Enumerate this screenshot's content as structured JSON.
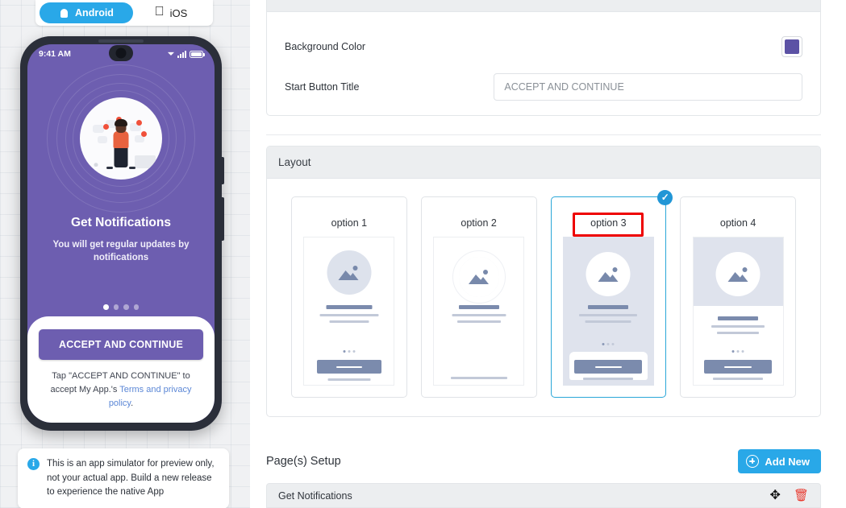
{
  "preview": {
    "platform_tabs": [
      {
        "label": "Android",
        "icon": "android-icon",
        "active": true
      },
      {
        "label": "iOS",
        "icon": "apple-icon",
        "active": false
      }
    ],
    "phone": {
      "status_time": "9:41 AM",
      "status_icons": [
        "wifi-icon",
        "signal-bars-icon",
        "battery-icon"
      ],
      "title": "Get Notifications",
      "subtitle": "You will get regular updates by notifications",
      "pager_dots": 4,
      "pager_active_index": 0,
      "cta_label": "ACCEPT AND CONTINUE",
      "note_prefix": "Tap \"ACCEPT AND CONTINUE\" to accept My App.'s ",
      "note_link": "Terms and privacy policy",
      "note_suffix": ".",
      "background_color": "#6d5eb0"
    },
    "simulator_note": "This is an app simulator for preview only, not your actual app. Build a new release to experience the native App"
  },
  "settings_card": {
    "background_color_label": "Background Color",
    "background_color_value": "#5c52a5",
    "start_button_title_label": "Start Button Title",
    "start_button_title_placeholder": "ACCEPT AND CONTINUE",
    "start_button_title_value": ""
  },
  "layout_card": {
    "header": "Layout",
    "options": [
      {
        "label": "option 1",
        "selected": false,
        "style": "plain-circle-top"
      },
      {
        "label": "option 2",
        "selected": false,
        "style": "rings-no-button"
      },
      {
        "label": "option 3",
        "selected": true,
        "style": "tinted-sheet-bottom",
        "annotated": true
      },
      {
        "label": "option 4",
        "selected": false,
        "style": "tinted-top-white-bottom"
      }
    ],
    "selected_index": 2,
    "check_icon": "check-icon",
    "accent_color": "#2aa7d8",
    "annotation_color": "#ee0000"
  },
  "pages_setup": {
    "title": "Page(s) Setup",
    "add_new_label": "Add New",
    "add_new_icon": "plus-circle-icon",
    "rows": [
      {
        "label": "Get Notifications",
        "move_icon": "move-icon",
        "delete_icon": "trash-icon"
      }
    ]
  }
}
